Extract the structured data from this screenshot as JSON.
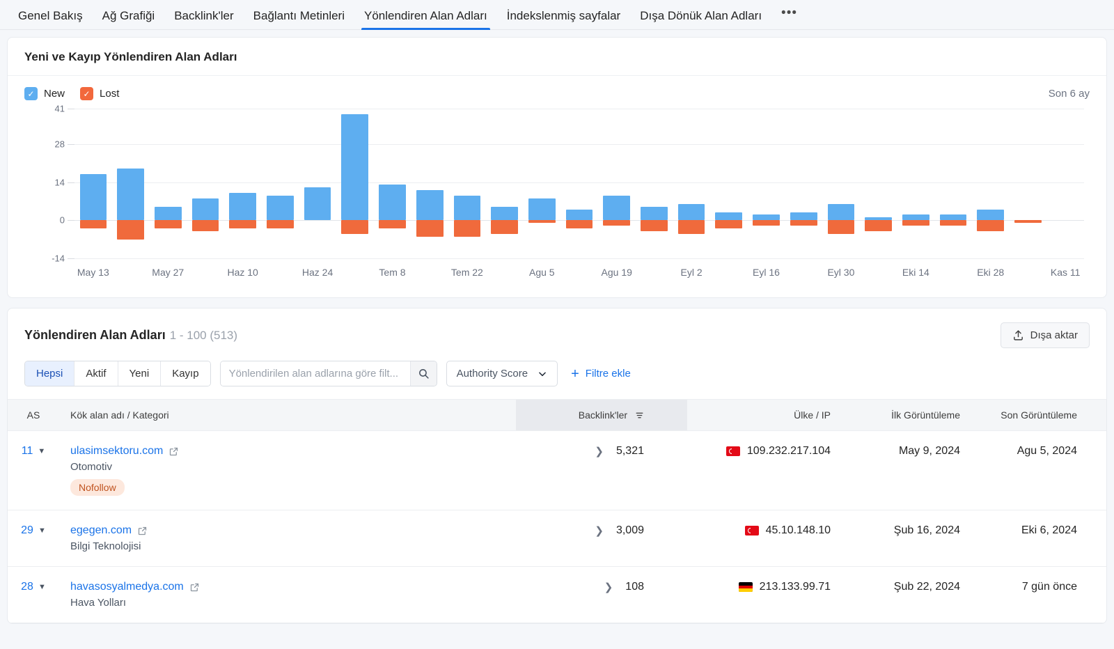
{
  "tabs": [
    {
      "label": "Genel Bakış",
      "active": false
    },
    {
      "label": "Ağ Grafiği",
      "active": false
    },
    {
      "label": "Backlink'ler",
      "active": false
    },
    {
      "label": "Bağlantı Metinleri",
      "active": false
    },
    {
      "label": "Yönlendiren Alan Adları",
      "active": true
    },
    {
      "label": "İndekslenmiş sayfalar",
      "active": false
    },
    {
      "label": "Dışa Dönük Alan Adları",
      "active": false
    }
  ],
  "tabs_more": "•••",
  "chart_card": {
    "title": "Yeni ve Kayıp Yönlendiren Alan Adları",
    "legend": [
      {
        "label": "New",
        "color": "#5eaef0",
        "checked": true
      },
      {
        "label": "Lost",
        "color": "#f2683c",
        "checked": true
      }
    ],
    "period": "Son 6 ay"
  },
  "chart_data": {
    "type": "bar",
    "title": "Yeni ve Kayıp Yönlendiren Alan Adları",
    "xlabel": "",
    "ylabel": "",
    "ylim": [
      -14,
      41
    ],
    "yticks": [
      41,
      28,
      14,
      0,
      -14
    ],
    "grid": true,
    "legend_position": "top-left",
    "stacked_around_zero": true,
    "categories": [
      "May 13",
      "May 20",
      "May 27",
      "Haz 3",
      "Haz 10",
      "Haz 17",
      "Haz 24",
      "Tem 1",
      "Tem 8",
      "Tem 15",
      "Tem 22",
      "Tem 29",
      "Agu 5",
      "Agu 12",
      "Agu 19",
      "Agu 26",
      "Eyl 2",
      "Eyl 9",
      "Eyl 16",
      "Eyl 23",
      "Eyl 30",
      "Eki 7",
      "Eki 14",
      "Eki 21",
      "Eki 28",
      "Kas 4",
      "Kas 11"
    ],
    "tick_labels": [
      "May 13",
      "May 27",
      "Haz 10",
      "Haz 24",
      "Tem 8",
      "Tem 22",
      "Agu 5",
      "Agu 19",
      "Eyl 2",
      "Eyl 16",
      "Eyl 30",
      "Eki 14",
      "Eki 28",
      "Kas 11"
    ],
    "series": [
      {
        "name": "New",
        "color": "#5eaef0",
        "values": [
          17,
          0,
          19,
          0,
          5,
          0,
          8,
          0,
          10,
          0,
          9,
          0,
          12,
          0,
          39,
          0,
          13,
          0,
          11,
          0,
          9,
          0,
          5,
          0,
          8,
          0,
          4,
          0,
          9,
          0,
          5,
          0,
          3,
          0,
          4,
          0,
          6,
          0,
          2,
          0,
          1,
          0,
          0
        ]
      },
      {
        "name": "Lost",
        "color": "#f06a3c",
        "values": [
          -3,
          0,
          -7,
          0,
          -3,
          0,
          -4,
          0,
          -3,
          0,
          -3,
          0,
          0,
          0,
          -5,
          0,
          -3,
          0,
          -6,
          0,
          -6,
          0,
          -5,
          0,
          -1,
          0,
          -3,
          0,
          -2,
          0,
          -4,
          0,
          -6,
          0,
          -3,
          0,
          -2,
          0,
          -2,
          0,
          -5,
          0,
          -1
        ]
      }
    ],
    "bars": [
      {
        "label": "May 13",
        "new": 17,
        "lost": -3
      },
      {
        "label": "May 20",
        "new": 19,
        "lost": -7
      },
      {
        "label": "May 27",
        "new": 5,
        "lost": -3
      },
      {
        "label": "Haz 3",
        "new": 8,
        "lost": -4
      },
      {
        "label": "Haz 10",
        "new": 10,
        "lost": -3
      },
      {
        "label": "Haz 17",
        "new": 9,
        "lost": -3
      },
      {
        "label": "Haz 24",
        "new": 12,
        "lost": 0
      },
      {
        "label": "Tem 1",
        "new": 39,
        "lost": -5
      },
      {
        "label": "Tem 8",
        "new": 13,
        "lost": -3
      },
      {
        "label": "Tem 15",
        "new": 11,
        "lost": -6
      },
      {
        "label": "Tem 22",
        "new": 9,
        "lost": -6
      },
      {
        "label": "Tem 29",
        "new": 5,
        "lost": -5
      },
      {
        "label": "Agu 5",
        "new": 8,
        "lost": -1
      },
      {
        "label": "Agu 12",
        "new": 4,
        "lost": -3
      },
      {
        "label": "Agu 19",
        "new": 9,
        "lost": -2
      },
      {
        "label": "Agu 26",
        "new": 5,
        "lost": -4
      },
      {
        "label": "Eyl 2",
        "new": 6,
        "lost": -5
      },
      {
        "label": "Eyl 9",
        "new": 3,
        "lost": -3
      },
      {
        "label": "Eyl 16",
        "new": 2,
        "lost": -2
      },
      {
        "label": "Eyl 23",
        "new": 3,
        "lost": -2
      },
      {
        "label": "Eyl 30",
        "new": 6,
        "lost": -5
      },
      {
        "label": "Eki 7",
        "new": 1,
        "lost": -4
      },
      {
        "label": "Eki 14",
        "new": 2,
        "lost": -2
      },
      {
        "label": "Eki 21",
        "new": 2,
        "lost": -2
      },
      {
        "label": "Eki 28",
        "new": 4,
        "lost": -4
      },
      {
        "label": "Kas 4",
        "new": 0,
        "lost": -1
      },
      {
        "label": "Kas 11",
        "new": 0,
        "lost": 0
      }
    ]
  },
  "table_card": {
    "title": "Yönlendiren Alan Adları",
    "count": "1 - 100 (513)",
    "export_label": "Dışa aktar",
    "export_icon": "upload-icon",
    "segments": [
      {
        "label": "Hepsi",
        "active": true
      },
      {
        "label": "Aktif",
        "active": false
      },
      {
        "label": "Yeni",
        "active": false
      },
      {
        "label": "Kayıp",
        "active": false
      }
    ],
    "search_placeholder": "Yönlendirilen alan adlarına göre filt...",
    "search_value": "",
    "search_icon": "search-icon",
    "select_label": "Authority Score",
    "add_filter_label": "Filtre ekle",
    "columns": [
      {
        "key": "as",
        "label": "AS"
      },
      {
        "key": "domain",
        "label": "Kök alan adı / Kategori"
      },
      {
        "key": "backlinks",
        "label": "Backlink'ler",
        "sorted": true
      },
      {
        "key": "ip",
        "label": "Ülke / IP"
      },
      {
        "key": "first_seen",
        "label": "İlk Görüntüleme"
      },
      {
        "key": "last_seen",
        "label": "Son Görüntüleme"
      }
    ],
    "rows": [
      {
        "as": "11",
        "domain": "ulasimsektoru.com",
        "category": "Otomotiv",
        "badge": "Nofollow",
        "backlinks": "5,321",
        "country": "tr",
        "ip": "109.232.217.104",
        "first_seen": "May 9, 2024",
        "last_seen": "Agu 5, 2024"
      },
      {
        "as": "29",
        "domain": "egegen.com",
        "category": "Bilgi Teknolojisi",
        "badge": "",
        "backlinks": "3,009",
        "country": "tr",
        "ip": "45.10.148.10",
        "first_seen": "Şub 16, 2024",
        "last_seen": "Eki 6, 2024"
      },
      {
        "as": "28",
        "domain": "havasosyalmedya.com",
        "category": "Hava Yolları",
        "badge": "",
        "backlinks": "108",
        "country": "de",
        "ip": "213.133.99.71",
        "first_seen": "Şub 22, 2024",
        "last_seen": "7 gün önce"
      }
    ]
  }
}
